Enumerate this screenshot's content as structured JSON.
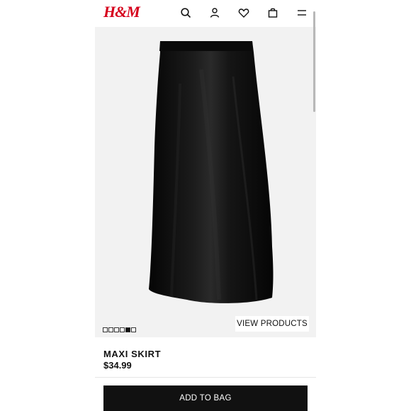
{
  "header": {
    "logo_text": "H&M",
    "icons": [
      "search-icon",
      "account-icon",
      "favorites-icon",
      "bag-icon",
      "menu-icon"
    ]
  },
  "gallery": {
    "total_images": 6,
    "active_index": 4,
    "view_products_label": "VIEW PRODUCTS"
  },
  "product": {
    "name": "MAXI SKIRT",
    "price": "$34.99"
  },
  "actions": {
    "add_to_bag_label": "ADD TO BAG"
  },
  "colors": {
    "brand": "#d6001c",
    "button_bg": "#111111",
    "image_bg": "#f2f2f2"
  }
}
